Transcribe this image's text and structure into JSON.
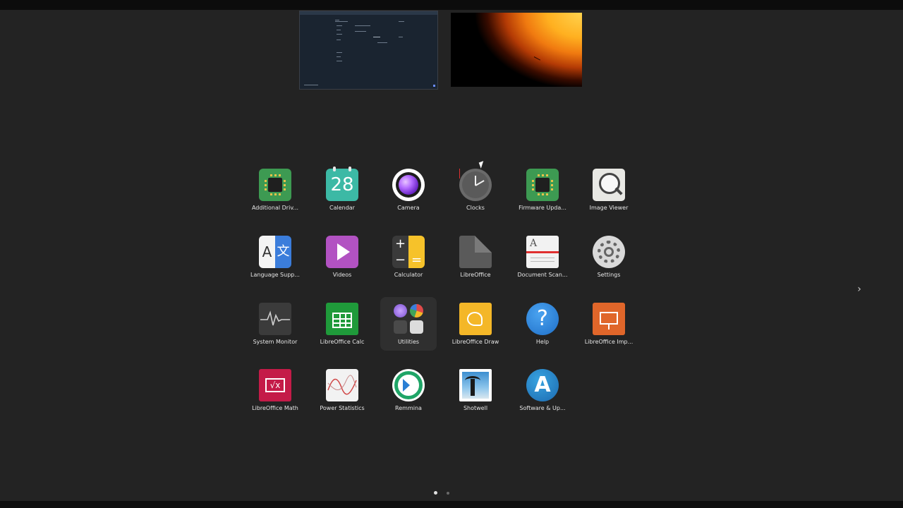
{
  "apps": [
    {
      "name": "Additional Driv...",
      "icon": "chip-icon"
    },
    {
      "name": "Calendar",
      "icon": "calendar-icon",
      "badge": "28"
    },
    {
      "name": "Camera",
      "icon": "camera-icon"
    },
    {
      "name": "Clocks",
      "icon": "clock-icon"
    },
    {
      "name": "Firmware Upda...",
      "icon": "chip-icon"
    },
    {
      "name": "Image Viewer",
      "icon": "magnifier-icon"
    },
    {
      "name": "Language Supp...",
      "icon": "language-icon",
      "glyph_left": "A",
      "glyph_right": "文"
    },
    {
      "name": "Videos",
      "icon": "play-icon"
    },
    {
      "name": "Calculator",
      "icon": "calculator-icon"
    },
    {
      "name": "LibreOffice",
      "icon": "document-icon"
    },
    {
      "name": "Document Scan...",
      "icon": "scanner-icon",
      "glyph": "A"
    },
    {
      "name": "Settings",
      "icon": "gear-icon"
    },
    {
      "name": "System Monitor",
      "icon": "pulse-icon"
    },
    {
      "name": "LibreOffice Calc",
      "icon": "spreadsheet-icon"
    },
    {
      "name": "Utilities",
      "icon": "folder-grid-icon"
    },
    {
      "name": "LibreOffice Draw",
      "icon": "draw-icon"
    },
    {
      "name": "Help",
      "icon": "question-icon",
      "glyph": "?"
    },
    {
      "name": "LibreOffice Imp...",
      "icon": "presentation-icon"
    },
    {
      "name": "LibreOffice Math",
      "icon": "formula-icon",
      "glyph": "√x"
    },
    {
      "name": "Power Statistics",
      "icon": "chart-icon"
    },
    {
      "name": "Remmina",
      "icon": "remote-desktop-icon"
    },
    {
      "name": "Shotwell",
      "icon": "photo-icon"
    },
    {
      "name": "Software & Up...",
      "icon": "app-store-icon",
      "glyph": "A"
    }
  ],
  "selected_app": "Utilities",
  "navigation": {
    "next_glyph": "›"
  },
  "pagination": {
    "pages": 2,
    "current": 1
  },
  "colors": {
    "background": "#232323",
    "selected_tile": "#2f2f2f",
    "page_dot_active": "#e0e0e0",
    "page_dot_inactive": "#6a6a6a"
  }
}
